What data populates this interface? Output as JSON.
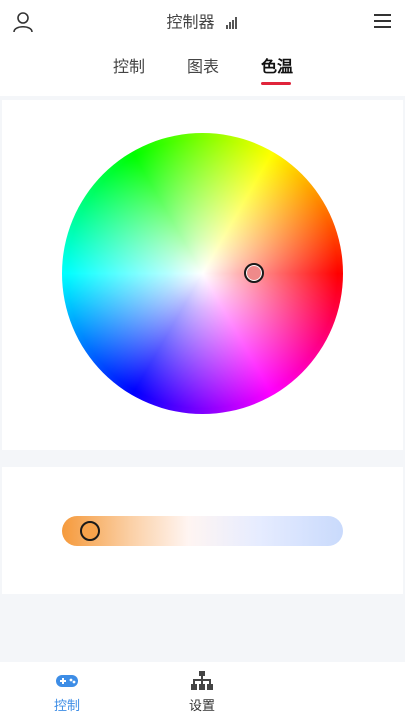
{
  "header": {
    "title": "控制器",
    "icons": {
      "user": "user-icon",
      "signal": "signal-icon",
      "menu": "menu-icon"
    }
  },
  "tabs": [
    {
      "label": "控制",
      "active": false
    },
    {
      "label": "图表",
      "active": false
    },
    {
      "label": "色温",
      "active": true
    }
  ],
  "color_wheel": {
    "selected_color": "#ef8a8a"
  },
  "temperature_slider": {
    "value": 0.05,
    "start_color": "#f59a3c",
    "end_color": "#c9dafc"
  },
  "bottom_nav": [
    {
      "label": "控制",
      "icon": "gamepad-icon",
      "active": true
    },
    {
      "label": "设置",
      "icon": "network-icon",
      "active": false
    }
  ],
  "colors": {
    "accent": "#3d8de6",
    "tab_indicator": "#e0243b"
  }
}
